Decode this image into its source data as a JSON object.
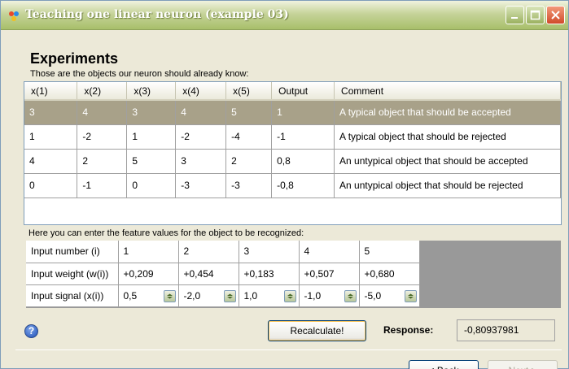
{
  "window": {
    "title": "Teaching one linear neuron (example 03)"
  },
  "experiments": {
    "heading": "Experiments",
    "subtitle": "Those are the objects our neuron should already know:",
    "columns": [
      "x(1)",
      "x(2)",
      "x(3)",
      "x(4)",
      "x(5)",
      "Output",
      "Comment"
    ],
    "rows": [
      [
        "3",
        "4",
        "3",
        "4",
        "5",
        "1",
        "A typical object that should be accepted"
      ],
      [
        "1",
        "-2",
        "1",
        "-2",
        "-4",
        "-1",
        "A typical object that should be rejected"
      ],
      [
        "4",
        "2",
        "5",
        "3",
        "2",
        "0,8",
        "An untypical object that should be accepted"
      ],
      [
        "0",
        "-1",
        "0",
        "-3",
        "-3",
        "-0,8",
        "An untypical object that should be rejected"
      ]
    ],
    "selected_row": 0
  },
  "input": {
    "subtitle": "Here you can enter the feature values for the object to be recognized:",
    "number_label": "Input number (i)",
    "weight_label": "Input weight (w(i))",
    "signal_label": "Input signal (x(i))",
    "numbers": [
      "1",
      "2",
      "3",
      "4",
      "5"
    ],
    "weights": [
      "+0,209",
      "+0,454",
      "+0,183",
      "+0,507",
      "+0,680"
    ],
    "signals": [
      "0,5",
      "-2,0",
      "1,0",
      "-1,0",
      "-5,0"
    ]
  },
  "actions": {
    "recalculate_label": "Recalculate!",
    "response_label": "Response:",
    "response_value": "-0,80937981",
    "back_label": "< Back",
    "next_label": "Next >",
    "help_glyph": "?"
  },
  "colors": {
    "selected_row": "#a8a189",
    "window_bg": "#ece9d8",
    "title_bar": "#b5c77f"
  }
}
